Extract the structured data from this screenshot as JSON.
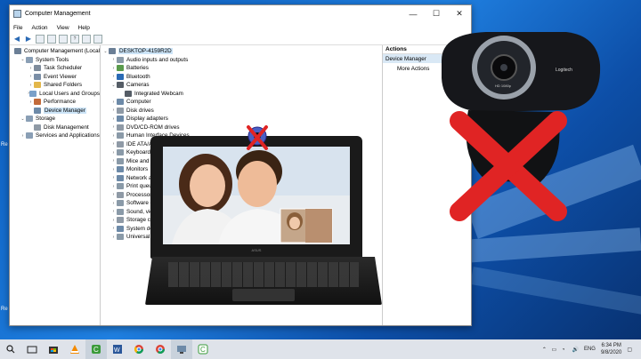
{
  "window": {
    "title": "Computer Management",
    "minimize": "—",
    "maximize": "☐",
    "close": "✕"
  },
  "menu": [
    "File",
    "Action",
    "View",
    "Help"
  ],
  "left_tree": [
    {
      "label": "Computer Management (Local",
      "exp": "",
      "color": "#6b7f96",
      "indent": 0
    },
    {
      "label": "System Tools",
      "exp": "⌄",
      "color": "#8a9fb5",
      "indent": 1
    },
    {
      "label": "Task Scheduler",
      "exp": "›",
      "color": "#7f8c9c",
      "indent": 2
    },
    {
      "label": "Event Viewer",
      "exp": "›",
      "color": "#7a8ea6",
      "indent": 2
    },
    {
      "label": "Shared Folders",
      "exp": "›",
      "color": "#e3b74a",
      "indent": 2
    },
    {
      "label": "Local Users and Groups",
      "exp": "›",
      "color": "#7aa0c9",
      "indent": 2
    },
    {
      "label": "Performance",
      "exp": "›",
      "color": "#c26a3a",
      "indent": 2
    },
    {
      "label": "Device Manager",
      "exp": "",
      "color": "#6d8aa8",
      "indent": 2,
      "selected": true
    },
    {
      "label": "Storage",
      "exp": "⌄",
      "color": "#8a9fb5",
      "indent": 1
    },
    {
      "label": "Disk Management",
      "exp": "",
      "color": "#8f9aa6",
      "indent": 2
    },
    {
      "label": "Services and Applications",
      "exp": "›",
      "color": "#8a9fb5",
      "indent": 1
    }
  ],
  "device_tree": [
    {
      "label": "DESKTOP-4159R2D",
      "exp": "⌄",
      "color": "#6b7f96",
      "indent": 0,
      "selected": true
    },
    {
      "label": "Audio inputs and outputs",
      "exp": "›",
      "color": "#8a9aa8",
      "indent": 1
    },
    {
      "label": "Batteries",
      "exp": "›",
      "color": "#5a9b4c",
      "indent": 1
    },
    {
      "label": "Bluetooth",
      "exp": "›",
      "color": "#2a6ab5",
      "indent": 1
    },
    {
      "label": "Cameras",
      "exp": "⌄",
      "color": "#555d66",
      "indent": 1
    },
    {
      "label": "Integrated Webcam",
      "exp": "",
      "color": "#555d66",
      "indent": 2
    },
    {
      "label": "Computer",
      "exp": "›",
      "color": "#6d8aa8",
      "indent": 1
    },
    {
      "label": "Disk drives",
      "exp": "›",
      "color": "#8f9aa6",
      "indent": 1
    },
    {
      "label": "Display adapters",
      "exp": "›",
      "color": "#6d8aa8",
      "indent": 1
    },
    {
      "label": "DVD/CD-ROM drives",
      "exp": "›",
      "color": "#8f9aa6",
      "indent": 1
    },
    {
      "label": "Human Interface Devices",
      "exp": "›",
      "color": "#8a9aa8",
      "indent": 1
    },
    {
      "label": "IDE ATA/ATAPI",
      "exp": "›",
      "color": "#8f9aa6",
      "indent": 1
    },
    {
      "label": "Keyboards",
      "exp": "›",
      "color": "#8a9aa8",
      "indent": 1
    },
    {
      "label": "Mice and oth",
      "exp": "›",
      "color": "#8a9aa8",
      "indent": 1
    },
    {
      "label": "Monitors",
      "exp": "›",
      "color": "#6d8aa8",
      "indent": 1
    },
    {
      "label": "Network ada",
      "exp": "›",
      "color": "#6d8aa8",
      "indent": 1
    },
    {
      "label": "Print queues",
      "exp": "›",
      "color": "#8a9aa8",
      "indent": 1
    },
    {
      "label": "Processors",
      "exp": "›",
      "color": "#8f9aa6",
      "indent": 1
    },
    {
      "label": "Software dev",
      "exp": "›",
      "color": "#8a9aa8",
      "indent": 1
    },
    {
      "label": "Sound, video",
      "exp": "›",
      "color": "#8a9aa8",
      "indent": 1
    },
    {
      "label": "Storage contr",
      "exp": "›",
      "color": "#8f9aa6",
      "indent": 1
    },
    {
      "label": "System devic",
      "exp": "›",
      "color": "#6d8aa8",
      "indent": 1
    },
    {
      "label": "Universal Ser",
      "exp": "›",
      "color": "#8a9aa8",
      "indent": 1
    }
  ],
  "actions": {
    "header": "Actions",
    "selected": "Device Manager",
    "more": "More Actions"
  },
  "laptop": {
    "brand": "ASUS"
  },
  "webcam": {
    "model": "HD 1080p",
    "brand": "Logitech"
  },
  "taskbar": {
    "lang": "ENG",
    "time": "6:34 PM",
    "date": "9/8/2020"
  },
  "colors": {
    "x_mark": "#e02424",
    "accent": "#0078d7"
  }
}
